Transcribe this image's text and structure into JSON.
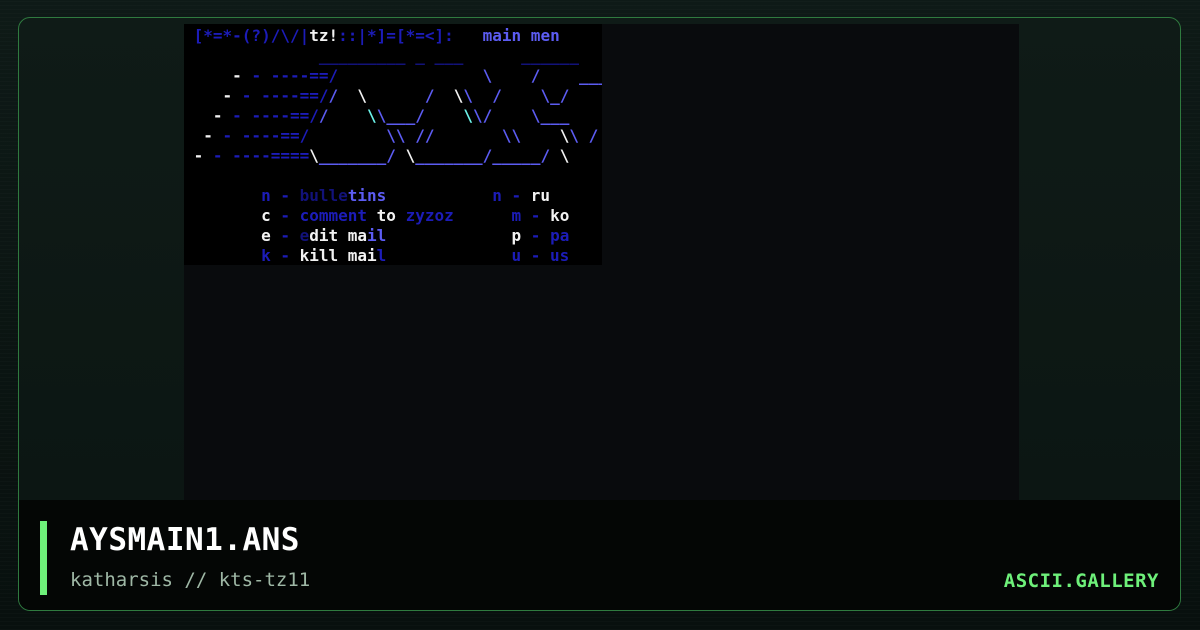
{
  "artwork": {
    "filename": "AYSMAIN1.ANS",
    "credit": "katharsis // kts-tz11",
    "ansi_lines": [
      [
        [
          "b",
          " [*=*-(?)/\\/|"
        ],
        [
          "w",
          "tz!"
        ],
        [
          "b",
          "::|*]=[*=<]:   "
        ],
        [
          "l",
          "main men"
        ]
      ],
      [
        [
          "b",
          "              "
        ],
        [
          "d",
          "_________ _ ___      ______"
        ]
      ],
      [
        [
          "w",
          "     - "
        ],
        [
          "b",
          "- ----==/      "
        ],
        [
          "l",
          "         \\    /    ___"
        ]
      ],
      [
        [
          "w",
          "    - "
        ],
        [
          "b",
          "- ----==/"
        ],
        [
          "l",
          "/"
        ],
        [
          "w",
          "  \\      "
        ],
        [
          "l",
          "/  "
        ],
        [
          "w",
          "\\"
        ],
        [
          "l",
          "\\  /    \\_/"
        ]
      ],
      [
        [
          "w",
          "   - "
        ],
        [
          "b",
          "- ----==/"
        ],
        [
          "l",
          "/    "
        ],
        [
          "c",
          "\\"
        ],
        [
          "l",
          "\\___/"
        ],
        [
          "l",
          "    "
        ],
        [
          "c",
          "\\"
        ],
        [
          "l",
          "\\/    \\___"
        ]
      ],
      [
        [
          "w",
          "  - "
        ],
        [
          "b",
          "- ----==/"
        ],
        [
          "l",
          "        \\\\ //       \\\\    "
        ],
        [
          "w",
          "\\"
        ],
        [
          "l",
          "\\ /"
        ]
      ],
      [
        [
          "w",
          " - "
        ],
        [
          "b",
          "- ----===="
        ],
        [
          "w",
          "\\"
        ],
        [
          "l",
          "_______/ "
        ],
        [
          "w",
          "\\"
        ],
        [
          "l",
          "_______/_____/ "
        ],
        [
          "w",
          "\\"
        ]
      ],
      [
        [
          "b",
          " "
        ]
      ],
      [
        [
          "b",
          "        n - "
        ],
        [
          "d",
          "bulle"
        ],
        [
          "l",
          "tins"
        ],
        [
          "b",
          "           n - "
        ],
        [
          "w",
          "ru"
        ]
      ],
      [
        [
          "w",
          "        c "
        ],
        [
          "b",
          "- comment "
        ],
        [
          "w",
          "to "
        ],
        [
          "b",
          "zyzoz"
        ],
        [
          "b",
          "      m - "
        ],
        [
          "w",
          "ko"
        ]
      ],
      [
        [
          "w",
          "        e "
        ],
        [
          "b",
          "- "
        ],
        [
          "d",
          "e"
        ],
        [
          "w",
          "dit ma"
        ],
        [
          "l",
          "il"
        ],
        [
          "b",
          "             "
        ],
        [
          "w",
          "p "
        ],
        [
          "b",
          "- pa"
        ]
      ],
      [
        [
          "b",
          "        k - "
        ],
        [
          "w",
          "kill mai"
        ],
        [
          "b",
          "l             u - us"
        ]
      ]
    ]
  },
  "brand": {
    "name": "ASCII.GALLERY",
    "accent_color": "#6ef07a",
    "border_color": "#2f7a3f"
  }
}
